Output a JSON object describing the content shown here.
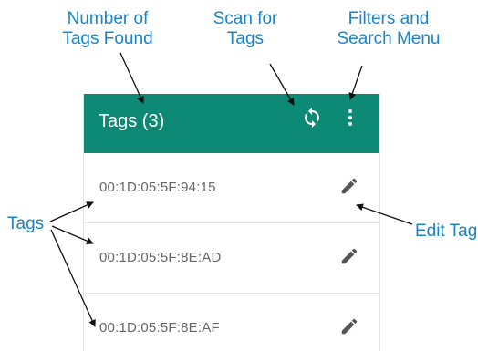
{
  "annotations": {
    "number_of_tags": [
      "Number of",
      "Tags Found"
    ],
    "scan_for_tags": [
      "Scan for",
      "Tags"
    ],
    "filters_and_search": [
      "Filters and",
      "Search Menu"
    ],
    "tags": "Tags",
    "edit_tag": "Edit Tag"
  },
  "toolbar": {
    "title": "Tags (3)",
    "scan_icon": "sync-icon",
    "menu_icon": "more-vertical-icon",
    "background": "#0d8a76"
  },
  "tags": [
    {
      "id": "00:1D:05:5F:94:15",
      "action_icon": "pencil-icon"
    },
    {
      "id": "00:1D:05:5F:8E:AD",
      "action_icon": "pencil-icon"
    },
    {
      "id": "00:1D:05:5F:8E:AF",
      "action_icon": "pencil-icon"
    }
  ],
  "colors": {
    "annotation": "#1a84c6",
    "tag_text": "#666666",
    "icon": "#555555"
  }
}
